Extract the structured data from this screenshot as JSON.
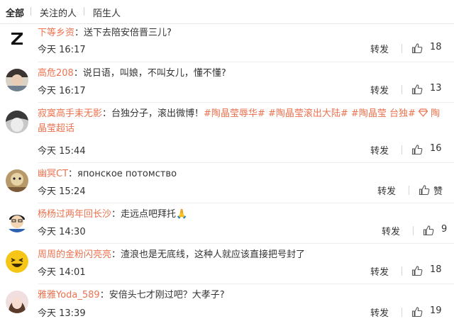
{
  "tabs": [
    "全部",
    "关注的人",
    "陌生人"
  ],
  "comments": [
    {
      "user": "下等乡资",
      "colon": "：",
      "text": "送下去陪安倍晋三儿?",
      "time": "今天 16:17",
      "forward": "转发",
      "likes": "18"
    },
    {
      "user": "高危208",
      "colon": "：",
      "text": "说日语，叫娘，不叫女儿，懂不懂?",
      "time": "今天 16:17",
      "forward": "转发",
      "likes": "13"
    },
    {
      "user": "寂寞高手耒无影",
      "colon": "：",
      "text": "台独分子，滚出微博！",
      "topics": [
        "#陶晶莹辱华#",
        "#陶晶莹滚出大陆#",
        "#陶晶莹 台独#"
      ],
      "super_topic_icon": "diamond-icon",
      "super_topic": "陶晶莹超话",
      "time": "今天 15:44",
      "forward": "转发",
      "likes": "16"
    },
    {
      "user": "幽冥CT",
      "colon": "：",
      "text": "японское потомство",
      "time": "今天 15:24",
      "forward": "转发",
      "likes": "赞"
    },
    {
      "user": "杨杨过两年回长沙",
      "colon": "：",
      "text": "走远点吧拜托🙏",
      "time": "今天 14:30",
      "forward": "转发",
      "likes": "9"
    },
    {
      "user": "周周的金粉闪亮亮",
      "colon": "：",
      "text": "渣浪也是无底线，这种人就应该直接把号封了",
      "time": "今天 14:01",
      "forward": "转发",
      "likes": "18"
    },
    {
      "user": "雅雅Yoda_589",
      "colon": "：",
      "text": "安倍头七才刚过吧？大孝子?",
      "time": "今天 13:39",
      "forward": "转发",
      "likes": "19"
    }
  ],
  "colors": {
    "username": "#eb7350",
    "text": "#333333",
    "divider": "#eeeeee"
  }
}
